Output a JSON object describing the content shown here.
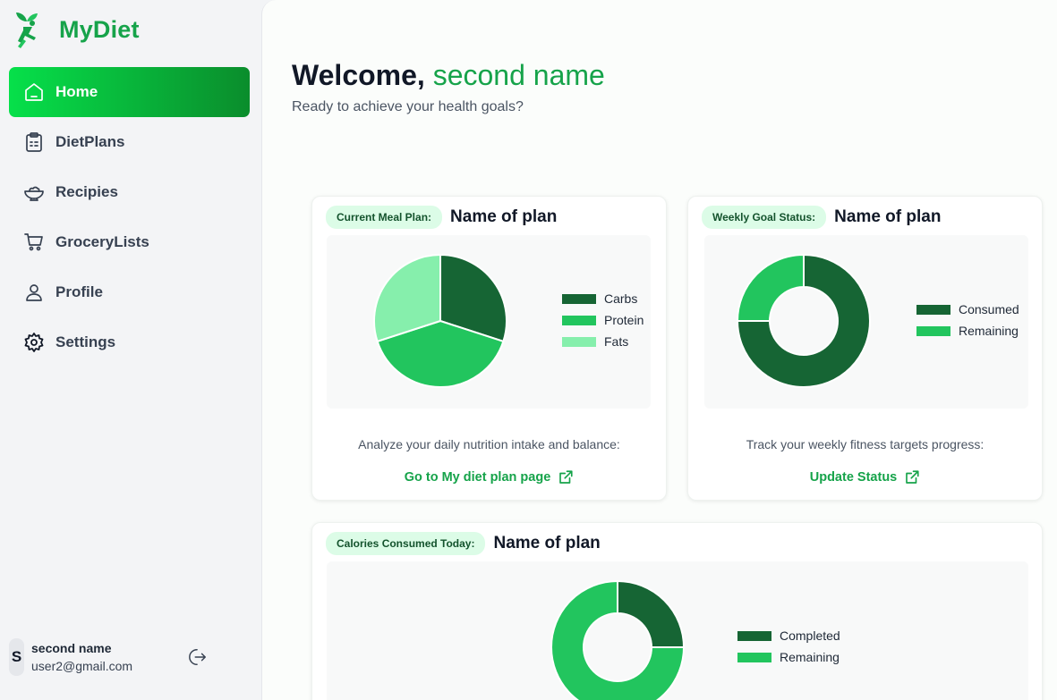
{
  "brand": {
    "name": "MyDiet"
  },
  "sidebar": {
    "items": [
      {
        "label": "Home",
        "icon": "home-icon",
        "active": true
      },
      {
        "label": "DietPlans",
        "icon": "clipboard-icon"
      },
      {
        "label": "Recipies",
        "icon": "bowl-icon"
      },
      {
        "label": "GroceryLists",
        "icon": "cart-icon"
      },
      {
        "label": "Profile",
        "icon": "user-icon"
      },
      {
        "label": "Settings",
        "icon": "gear-icon"
      }
    ]
  },
  "user": {
    "initial": "S",
    "name": "second name",
    "email": "user2@gmail.com"
  },
  "main": {
    "welcome_prefix": "Welcome,",
    "welcome_name": "second name",
    "subtitle": "Ready to achieve your health goals?"
  },
  "cards": {
    "meal": {
      "pill": "Current Meal Plan:",
      "plan_name": "Name of plan",
      "description": "Analyze your daily nutrition intake and balance:",
      "link": "Go to My diet plan page"
    },
    "weekly": {
      "pill": "Weekly Goal Status:",
      "plan_name": "Name of plan",
      "description": "Track your weekly fitness targets progress:",
      "link": "Update Status"
    },
    "calories": {
      "pill": "Calories Consumed Today:",
      "plan_name": "Name of plan"
    }
  },
  "colors": {
    "dark": "#166534",
    "mid": "#22c55e",
    "light": "#86efac",
    "accent": "#16a34a"
  },
  "chart_data": [
    {
      "type": "pie",
      "labels": [
        "Carbs",
        "Protein",
        "Fats"
      ],
      "values": [
        30,
        40,
        30
      ],
      "colors": [
        "#166534",
        "#22c55e",
        "#86efac"
      ],
      "legend": "right"
    },
    {
      "type": "pie",
      "donut": true,
      "labels": [
        "Consumed",
        "Remaining"
      ],
      "values": [
        75,
        25
      ],
      "colors": [
        "#166534",
        "#22c55e"
      ],
      "legend": "right"
    },
    {
      "type": "pie",
      "donut": true,
      "labels": [
        "Completed",
        "Remaining"
      ],
      "values": [
        25,
        75
      ],
      "colors": [
        "#166534",
        "#22c55e"
      ],
      "legend": "right"
    }
  ]
}
